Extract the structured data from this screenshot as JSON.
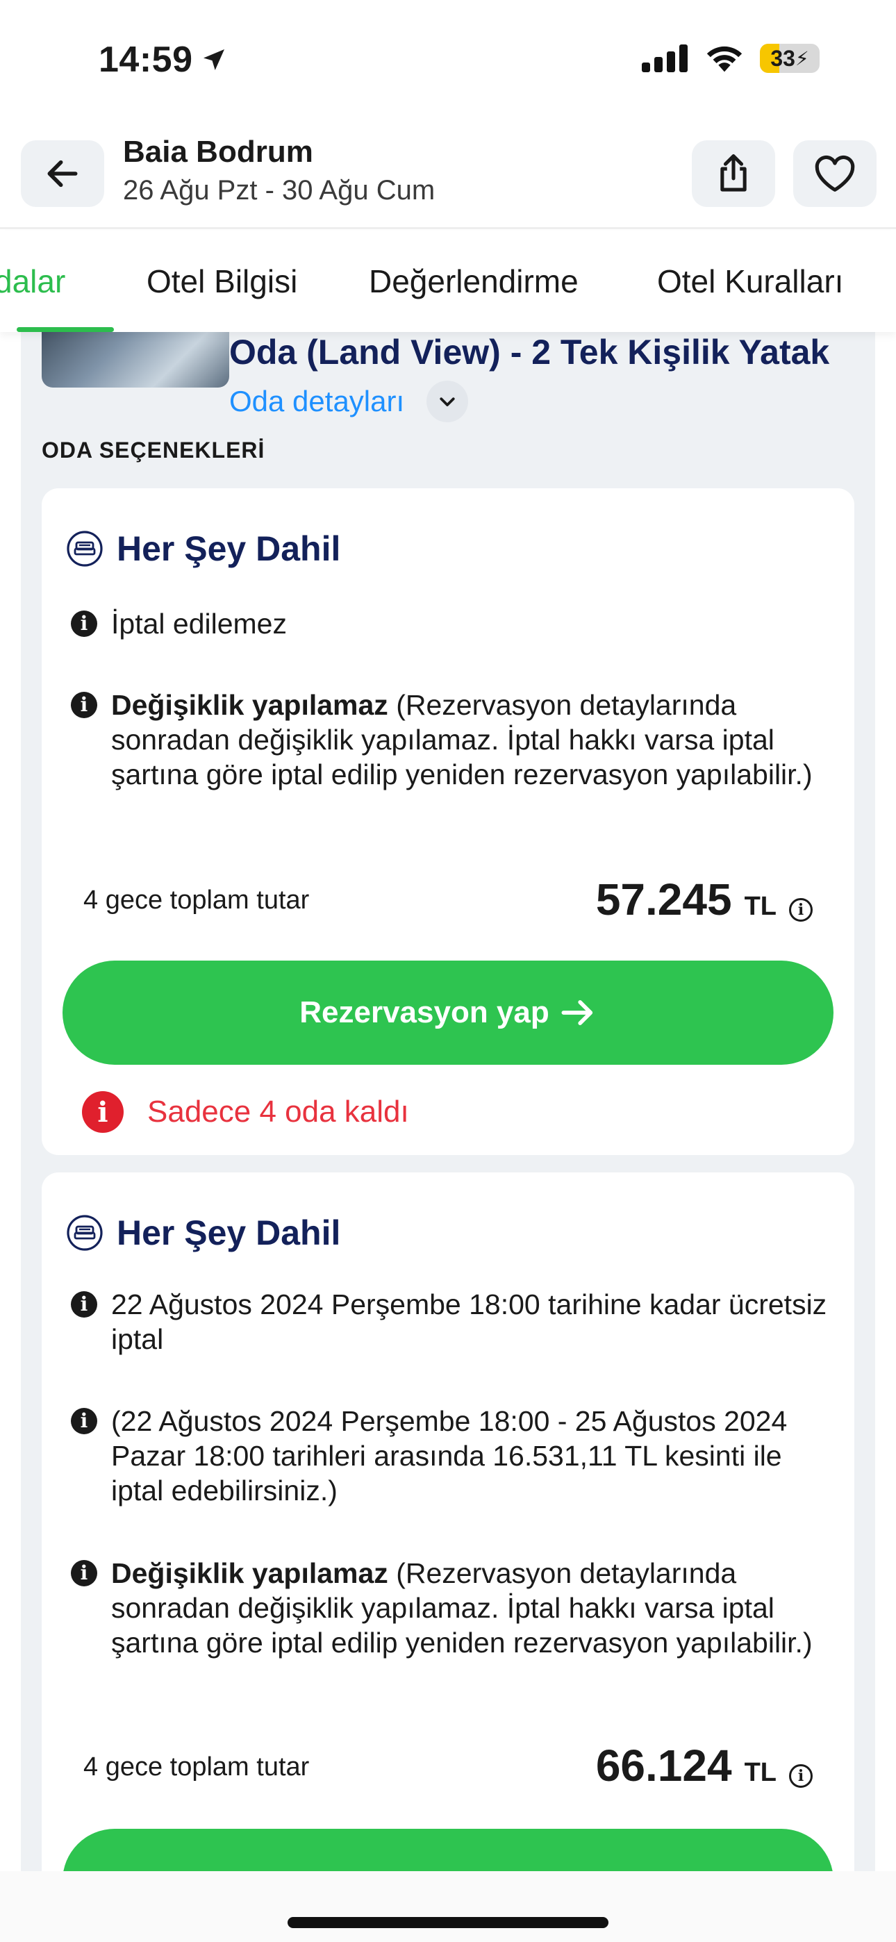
{
  "status_bar": {
    "time": "14:59",
    "battery": "33",
    "battery_level_percent": 33
  },
  "header": {
    "hotel_name": "Baia Bodrum",
    "dates": "26 Ağu Pzt - 30 Ağu Cum"
  },
  "tabs": [
    "dalar",
    "Otel Bilgisi",
    "Değerlendirme",
    "Otel Kuralları"
  ],
  "room": {
    "title": "Oda (Land View) - 2 Tek Kişilik Yatak",
    "details_link": "Oda detayları",
    "options_label": "ODA SEÇENEKLERİ"
  },
  "options": [
    {
      "plan": "Her Şey Dahil",
      "info_1": "İptal edilemez",
      "info_2_bold": "Değişiklik yapılamaz",
      "info_2_rest": " (Rezervasyon detaylarında sonradan değişiklik yapılamaz. İptal hakkı varsa iptal şartına göre iptal edilip yeniden rezervasyon yapılabilir.)",
      "total_label": "4 gece toplam tutar",
      "price": "57.245",
      "currency": "TL",
      "button": "Rezervasyon yap",
      "warning": "Sadece 4 oda kaldı"
    },
    {
      "plan": "Her Şey Dahil",
      "info_1": "22 Ağustos 2024  Perşembe 18:00 tarihine kadar ücretsiz iptal",
      "info_2": "(22 Ağustos 2024  Perşembe 18:00 - 25 Ağustos 2024  Pazar 18:00 tarihleri arasında 16.531,11 TL kesinti ile iptal edebilirsiniz.)",
      "info_3_bold": "Değişiklik yapılamaz",
      "info_3_rest": " (Rezervasyon detaylarında sonradan değişiklik yapılamaz. İptal hakkı varsa iptal şartına göre iptal edilip yeniden rezervasyon yapılabilir.)",
      "total_label": "4 gece toplam tutar",
      "price": "66.124",
      "currency": "TL"
    }
  ],
  "colors": {
    "accent_green": "#2ec450",
    "navy": "#13215a",
    "link_blue": "#1e90ff",
    "warning_red": "#e8323e"
  }
}
